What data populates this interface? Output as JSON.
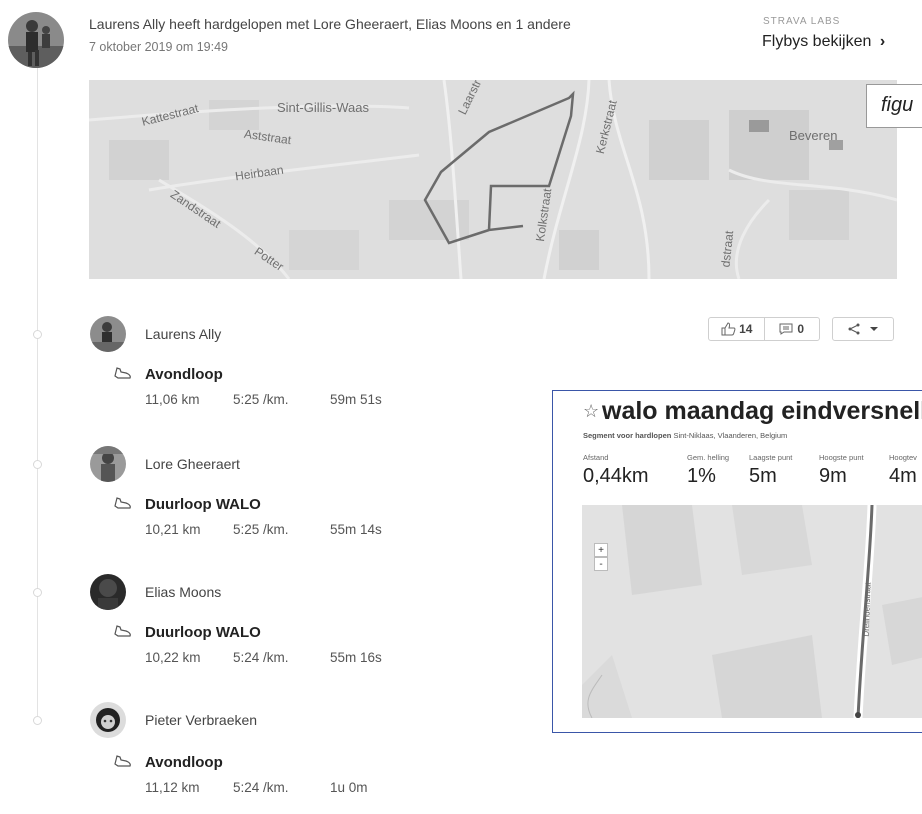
{
  "header": {
    "summary": "Laurens Ally heeft hardgelopen met Lore Gheeraert, Elias Moons en 1 andere",
    "date": "7 oktober 2019 om 19:49",
    "labs_label": "STRAVA LABS",
    "flyby_label": "Flybys bekijken",
    "flyby_chevron": "›"
  },
  "map": {
    "labels": [
      "Kattestraat",
      "Sint-Gillis-Waas",
      "Aststraat",
      "Heirbaan",
      "Zandstraat",
      "Potter",
      "Laarstr",
      "Kerkstraat",
      "Kolkstraat",
      "Beveren",
      "dstraat"
    ],
    "figure_label": "figu",
    "route_color": "#6b6b6b"
  },
  "social": {
    "kudos_count": "14",
    "comment_count": "0",
    "kudos_icon": "thumbs-up-icon",
    "comment_icon": "comment-icon",
    "share_icon": "share-icon"
  },
  "activities": [
    {
      "athlete": "Laurens Ally",
      "title": "Avondloop",
      "distance": "11,06 km",
      "pace": "5:25 /km.",
      "time": "59m 51s"
    },
    {
      "athlete": "Lore Gheeraert",
      "title": "Duurloop WALO",
      "distance": "10,21 km",
      "pace": "5:25 /km.",
      "time": "55m 14s"
    },
    {
      "athlete": "Elias Moons",
      "title": "Duurloop WALO",
      "distance": "10,22 km",
      "pace": "5:24 /km.",
      "time": "55m 16s"
    },
    {
      "athlete": "Pieter Verbraeken",
      "title": "Avondloop",
      "distance": "11,12 km",
      "pace": "5:24 /km.",
      "time": "1u 0m"
    }
  ],
  "segment": {
    "star": "☆",
    "title": "walo maandag eindversnellin",
    "subtitle_bold": "Segment voor hardlopen",
    "subtitle_rest": " Sint-Niklaas, Vlaanderen, Belgium",
    "stats": [
      {
        "label": "Afstand",
        "value": "0,44km"
      },
      {
        "label": "Gem. helling",
        "value": "1%"
      },
      {
        "label": "Laagste punt",
        "value": "5m"
      },
      {
        "label": "Hoogste punt",
        "value": "9m"
      },
      {
        "label": "Hoogtev",
        "value": "4m"
      }
    ],
    "zoom_in": "+",
    "zoom_out": "-",
    "street_label": "Dreiindenstraat",
    "border_color": "#3a56a8"
  }
}
